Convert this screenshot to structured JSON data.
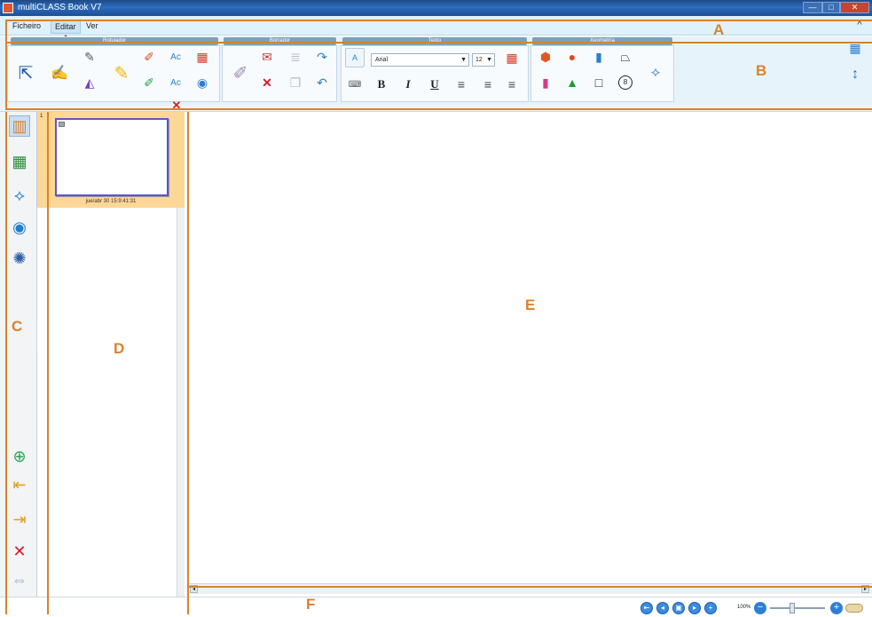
{
  "window": {
    "title": "multiCLASS Book V7",
    "min": "—",
    "max": "□",
    "close": "✕"
  },
  "menu": {
    "items": [
      {
        "label": "Ficheiro"
      },
      {
        "label": "Editar"
      },
      {
        "label": "Ver"
      }
    ],
    "collapse_symbol": "^"
  },
  "ribbon": {
    "groups": [
      {
        "label": "Rotulador"
      },
      {
        "label": "Borrador"
      },
      {
        "label": "Texto"
      },
      {
        "label": "Xeometría"
      }
    ],
    "font": {
      "value": "Arial"
    },
    "size": {
      "value": "12"
    },
    "text_buttons": {
      "bold": "B",
      "italic": "I",
      "underline": "U"
    },
    "octagon_value": "8"
  },
  "pages": {
    "page_number": "1",
    "page_date": "jue/abr 30 15:9:41:31",
    "close_symbol": "✕"
  },
  "status": {
    "zoom_label": "100%"
  },
  "annotations": {
    "a": "A",
    "b": "B",
    "c": "C",
    "d": "D",
    "e": "E",
    "f": "F"
  },
  "colors": {
    "annotation": "#d9822b",
    "page_strip": "#fdd796",
    "thumb_border": "#5d55c8"
  }
}
